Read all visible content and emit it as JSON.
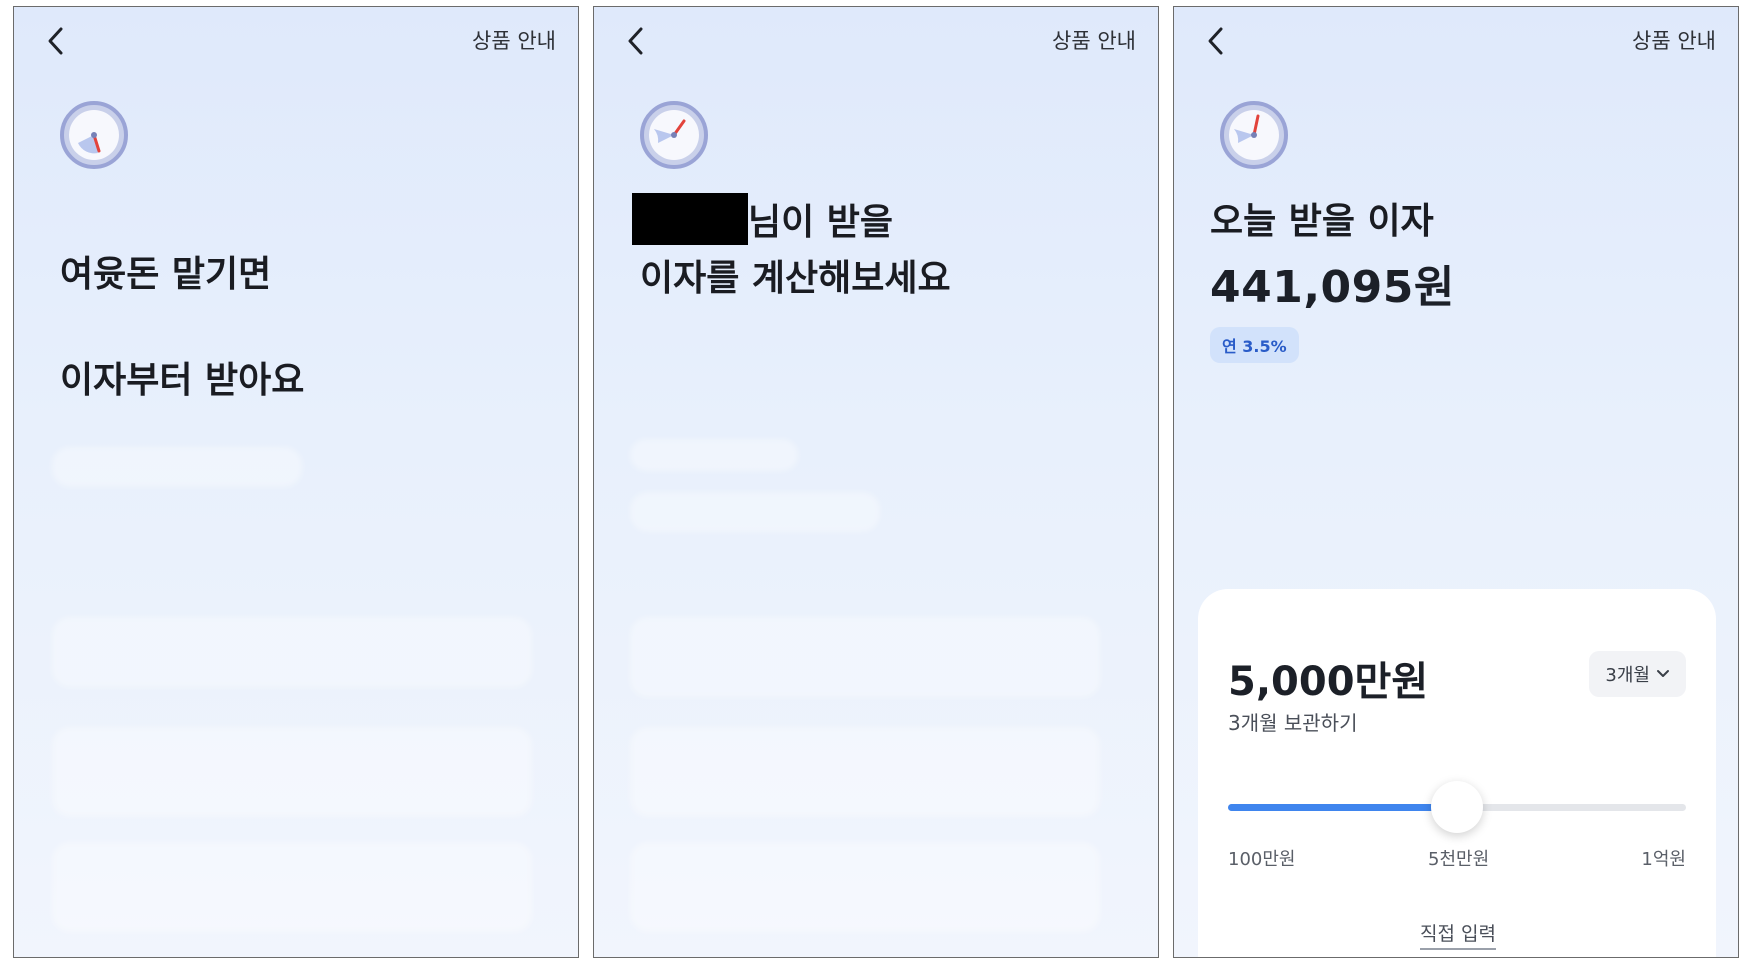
{
  "common": {
    "top_link": "상품 안내",
    "back_icon": "chevron-left-icon",
    "clock_icon": "clock-gauge-icon"
  },
  "panel1": {
    "headline_line1": "여윳돈 맡기면",
    "headline_line2": "이자부터 받아요"
  },
  "panel2": {
    "headline_line1_suffix": "님이 받을",
    "headline_line2": "이자를 계산해보세요"
  },
  "panel3": {
    "headline": "오늘 받을 이자",
    "amount": "441,095원",
    "rate_badge": "연 3.5%",
    "calculator": {
      "amount": "5,000만원",
      "subtitle": "3개월 보관하기",
      "period": "3개월",
      "slider_fraction": 0.5,
      "slider_min_label": "100만원",
      "slider_mid_label": "5천만원",
      "slider_max_label": "1억원",
      "direct_input": "직접 입력"
    }
  },
  "colors": {
    "accent": "#3f85ee",
    "badge_bg": "#d2e2fb",
    "badge_text": "#2a5cc8"
  }
}
